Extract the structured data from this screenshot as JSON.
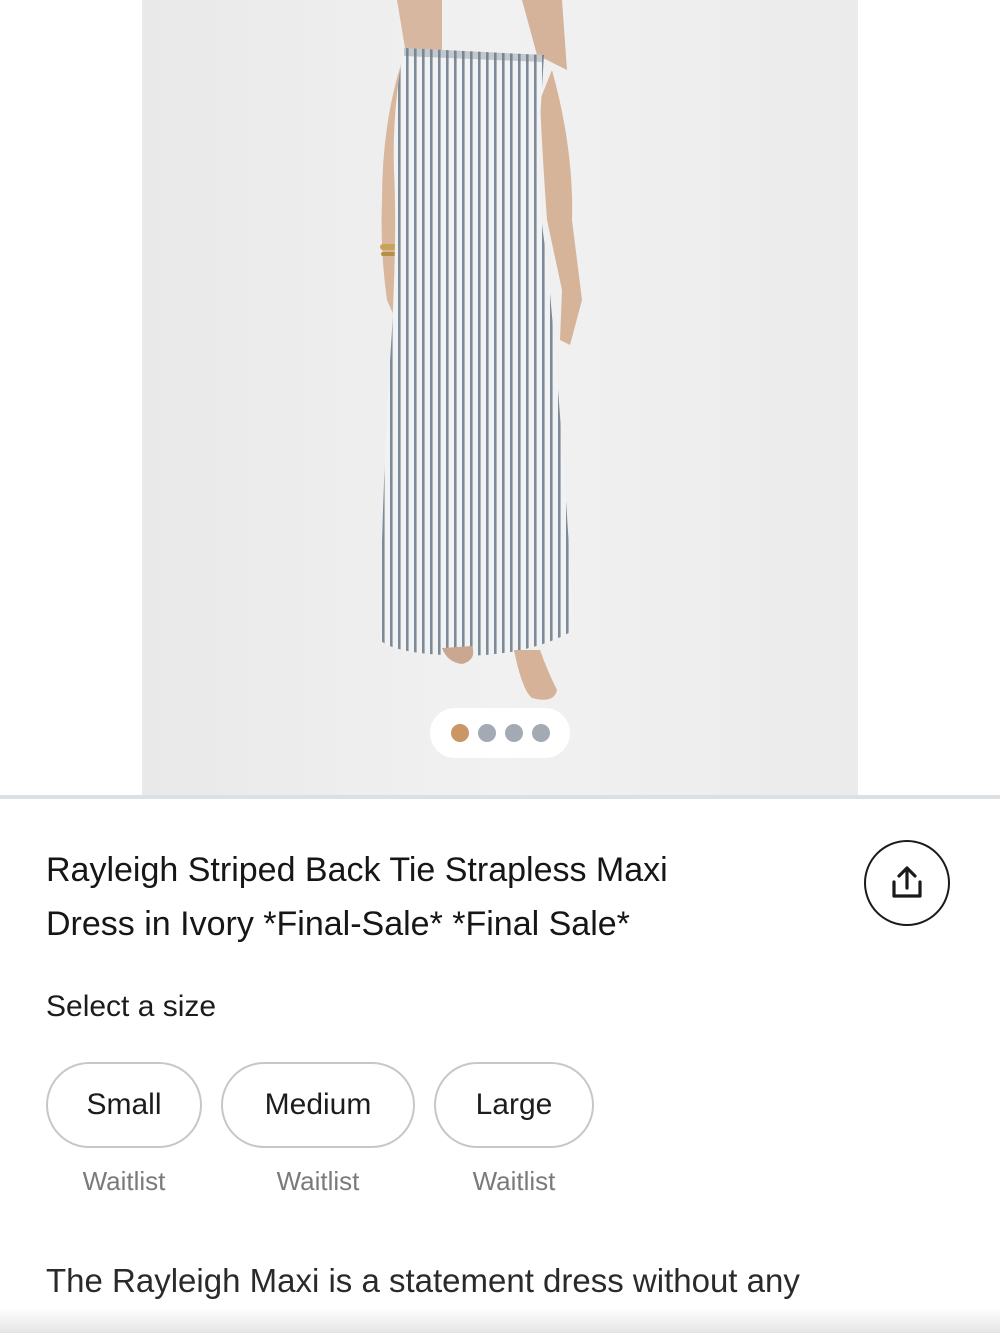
{
  "gallery": {
    "image_alt": "Model wearing striped strapless maxi dress",
    "slide_count": 4,
    "active_slide": 1
  },
  "colors": {
    "accent_dot": "#c99766",
    "inactive_dot": "#a3aab3"
  },
  "product": {
    "title_line1": "Rayleigh Striped Back Tie Strapless Maxi",
    "title_line2": "Dress in Ivory *Final-Sale* *Final Sale*",
    "share_icon": "share-icon"
  },
  "size_selector": {
    "label": "Select a size",
    "options": [
      {
        "label": "Small",
        "status": "Waitlist"
      },
      {
        "label": "Medium",
        "status": "Waitlist"
      },
      {
        "label": "Large",
        "status": "Waitlist"
      }
    ]
  },
  "description": {
    "text": "The Rayleigh Maxi is a statement dress without any"
  }
}
